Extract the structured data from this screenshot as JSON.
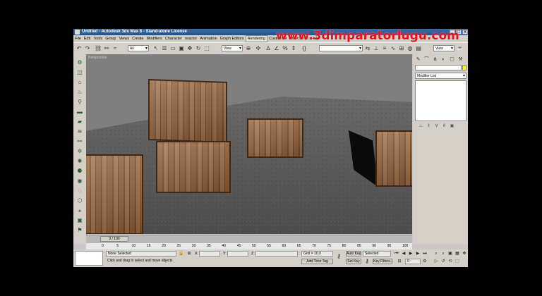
{
  "window": {
    "title": "Untitled - Autodesk 3ds Max 8 - Stand-alone License",
    "minimize": "_",
    "maximize": "□",
    "close": "×"
  },
  "watermark": "www.3dimparatorlugu.com",
  "menu": [
    "File",
    "Edit",
    "Tools",
    "Group",
    "Views",
    "Create",
    "Modifiers",
    "Character",
    "reactor",
    "Animation",
    "Graph Editors",
    "Rendering",
    "Customize",
    "MAXScript",
    "Help"
  ],
  "menu_active": "Rendering",
  "toolbar": {
    "selection_filter": "All",
    "reference_coord": "View",
    "named_selection": "",
    "render_view": "View"
  },
  "viewport": {
    "label": "Perspective"
  },
  "command_panel": {
    "tab_icons": [
      "create-icon",
      "modify-icon",
      "hierarchy-icon",
      "motion-icon",
      "display-icon",
      "utilities-icon"
    ],
    "name_value": "",
    "object_color": "#ffff00",
    "modifier_list": "Modifier List"
  },
  "timeline": {
    "slider_label": "0 / 100",
    "ticks": [
      "0",
      "5",
      "10",
      "15",
      "20",
      "25",
      "30",
      "35",
      "40",
      "45",
      "50",
      "55",
      "60",
      "65",
      "70",
      "75",
      "80",
      "85",
      "90",
      "95",
      "100"
    ]
  },
  "status": {
    "selection": "None Selected",
    "prompt": "Click and drag to select and move objects",
    "x_label": "X",
    "y_label": "Y",
    "z_label": "Z",
    "x_value": "",
    "y_value": "",
    "z_value": "",
    "grid": "Grid = 10,0",
    "add_time_tag": "Add Time Tag",
    "auto_key": "Auto Key",
    "set_key": "Set Key",
    "key_mode_value": "Selected",
    "key_filters": "Key Filters...",
    "frame": "0"
  }
}
